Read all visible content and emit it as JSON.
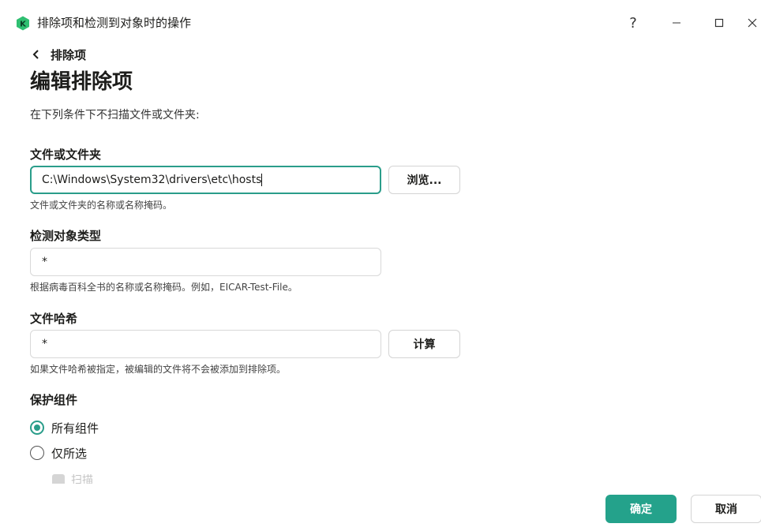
{
  "window": {
    "title": "排除项和检测到对象时的操作",
    "help_glyph": "?",
    "min_glyph": "—",
    "max_glyph": "☐",
    "close_glyph": "✕",
    "accent_color": "#24a28b"
  },
  "header": {
    "back_label": "排除项",
    "page_title": "编辑排除项",
    "description": "在下列条件下不扫描文件或文件夹:"
  },
  "file_section": {
    "label": "文件或文件夹",
    "value": "C:\\Windows\\System32\\drivers\\etc\\hosts",
    "browse_label": "浏览...",
    "hint": "文件或文件夹的名称或名称掩码。"
  },
  "object_type_section": {
    "label": "检测对象类型",
    "value": "*",
    "hint": "根据病毒百科全书的名称或名称掩码。例如，EICAR-Test-File。"
  },
  "hash_section": {
    "label": "文件哈希",
    "value": "*",
    "calc_label": "计算",
    "hint": "如果文件哈希被指定，被编辑的文件将不会被添加到排除项。"
  },
  "components_section": {
    "label": "保护组件",
    "options": [
      {
        "label": "所有组件",
        "selected": true
      },
      {
        "label": "仅所选",
        "selected": false
      }
    ],
    "partial_item_label": "扫描"
  },
  "footer": {
    "ok_label": "确定",
    "cancel_label": "取消"
  }
}
